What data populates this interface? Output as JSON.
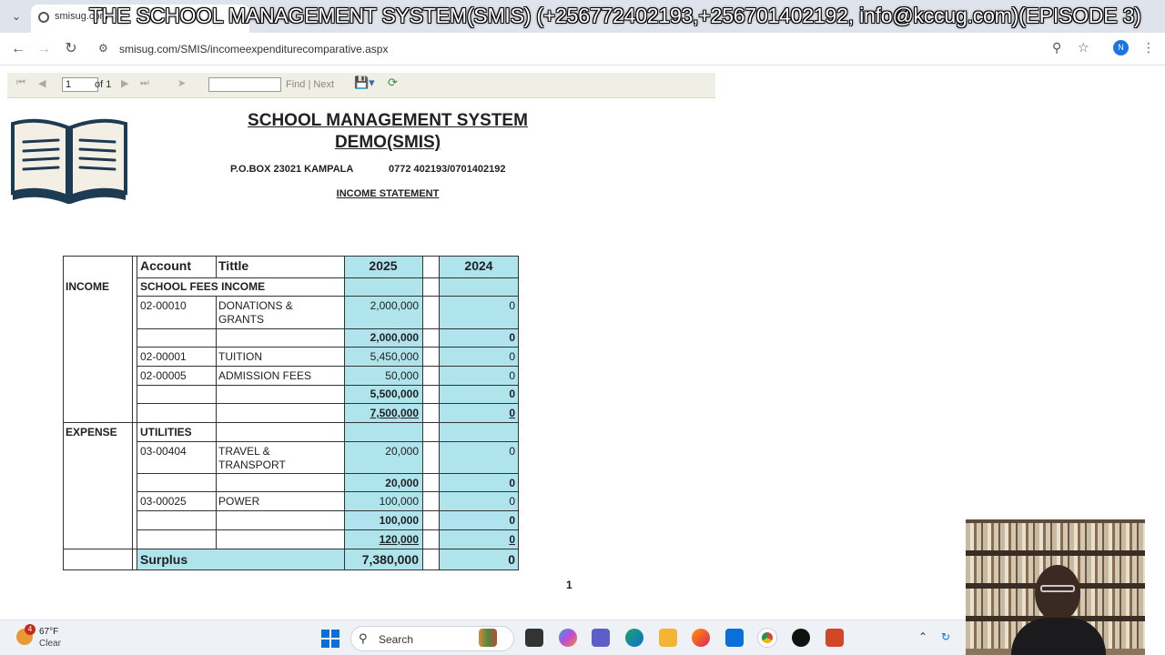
{
  "overlay": {
    "caption": "THE SCHOOL MANAGEMENT SYSTEM(SMIS) (+256772402193,+256701402192, info@kccug.com)(EPISODE 3)"
  },
  "browser": {
    "tab_title": "smisug.com",
    "url": "smisug.com/SMIS/incomeexpenditurecomparative.aspx",
    "avatar_letter": "N",
    "icons": [
      "back-icon",
      "forward-icon",
      "reload-icon",
      "site-settings-icon",
      "zoom-icon",
      "star-icon",
      "kebab-menu-icon"
    ]
  },
  "report_toolbar": {
    "page_value": "1",
    "page_of": "of 1",
    "find_label": "Find",
    "separator": "|",
    "next_label": "Next"
  },
  "report": {
    "title_line1": "SCHOOL MANAGEMENT SYSTEM",
    "title_line2": "DEMO(SMIS)",
    "address": "P.O.BOX 23021 KAMPALA",
    "phone": "0772 402193/0701402192",
    "statement": "INCOME STATEMENT",
    "page_number": "1",
    "headers": {
      "account": "Account",
      "title": "Tittle",
      "year1": "2025",
      "year2": "2024"
    },
    "income_label": "INCOME",
    "income_group": "SCHOOL FEES INCOME",
    "expense_label": "EXPENSE",
    "expense_group": "UTILITIES",
    "rows": [
      {
        "account": "02-00010",
        "title": "DONATIONS &",
        "title2": "GRANTS",
        "y1": "2,000,000",
        "y2": "0"
      },
      {
        "account": "",
        "title": "",
        "y1": "2,000,000",
        "y2": "0"
      },
      {
        "account": "02-00001",
        "title": "TUITION",
        "y1": "5,450,000",
        "y2": "0"
      },
      {
        "account": "02-00005",
        "title": "ADMISSION FEES",
        "y1": "50,000",
        "y2": "0"
      },
      {
        "account": "",
        "title": "",
        "y1": "5,500,000",
        "y2": "0"
      },
      {
        "account": "",
        "title": "",
        "y1": "7,500,000",
        "y2": "0"
      },
      {
        "account": "03-00404",
        "title": "TRAVEL &",
        "title2": "TRANSPORT",
        "y1": "20,000",
        "y2": "0"
      },
      {
        "account": "",
        "title": "",
        "y1": "20,000",
        "y2": "0"
      },
      {
        "account": "03-00025",
        "title": "POWER",
        "y1": "100,000",
        "y2": "0"
      },
      {
        "account": "",
        "title": "",
        "y1": "100,000",
        "y2": "0"
      },
      {
        "account": "",
        "title": "",
        "y1": "120,000",
        "y2": "0"
      }
    ],
    "surplus_label": "Surplus",
    "surplus_y1": "7,380,000",
    "surplus_y2": "0"
  },
  "taskbar": {
    "weather_badge": "4",
    "weather_temp": "67°F",
    "weather_desc": "Clear",
    "search_label": "Search"
  },
  "colors": {
    "highlight": "#b0e4ec",
    "chrome_tabbar": "#dfe3eb",
    "avatar": "#1a73e8"
  }
}
